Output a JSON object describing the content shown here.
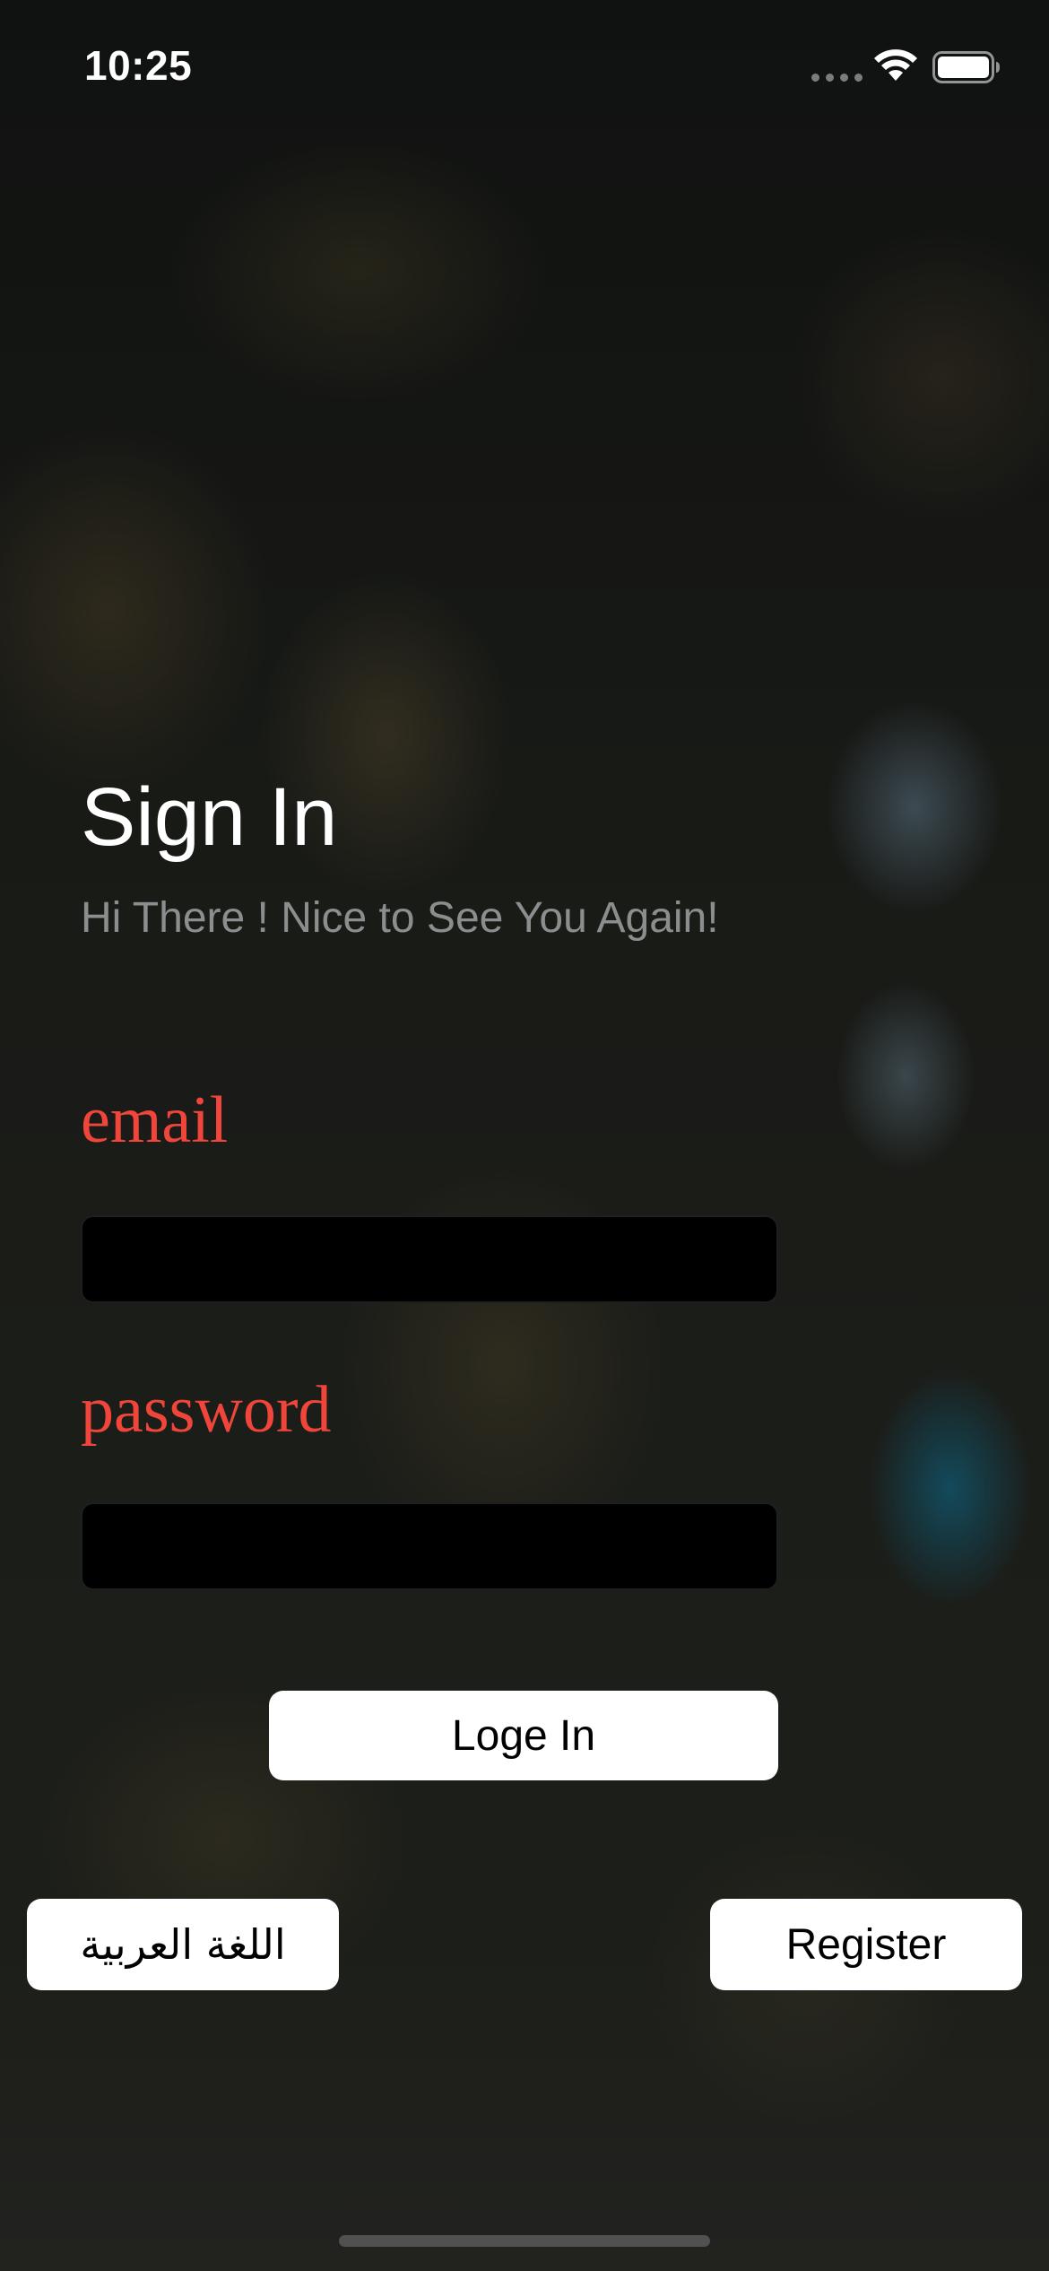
{
  "status_bar": {
    "time": "10:25",
    "icons": [
      "cellular-signal-icon",
      "wifi-icon",
      "battery-icon"
    ]
  },
  "header": {
    "title": "Sign In",
    "subtitle": "Hi There ! Nice to See You Again!"
  },
  "form": {
    "email_label": "email",
    "email_value": "",
    "password_label": "password",
    "password_value": "",
    "login_button": "Loge In"
  },
  "footer": {
    "language_button": "اللغة العربية",
    "register_button": "Register"
  },
  "colors": {
    "label_color": "#f0453a",
    "button_background": "#ffffff",
    "field_background": "#000000"
  }
}
